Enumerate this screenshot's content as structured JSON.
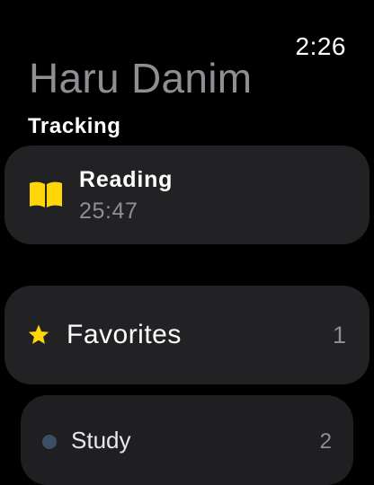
{
  "status": {
    "time": "2:26"
  },
  "header": {
    "title": "Haru Danim"
  },
  "tracking": {
    "section_label": "Tracking",
    "item": {
      "name": "Reading",
      "elapsed": "25:47",
      "icon": "book-icon",
      "icon_color": "#FFD60A"
    }
  },
  "lists": [
    {
      "label": "Favorites",
      "count": "1",
      "icon": "star-icon",
      "icon_color": "#FFD60A"
    },
    {
      "label": "Study",
      "count": "2",
      "icon": "dot-icon",
      "icon_color": "#3B5066"
    }
  ]
}
